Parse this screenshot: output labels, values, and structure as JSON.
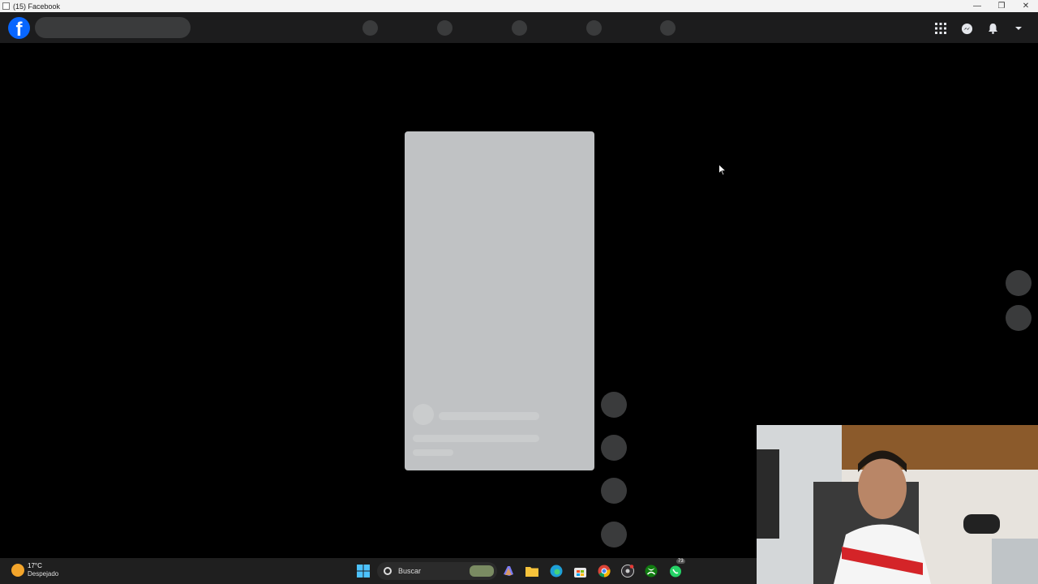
{
  "window": {
    "title": "(15) Facebook"
  },
  "taskbar": {
    "weather": {
      "temp": "17°C",
      "condition": "Despejado"
    },
    "search_label": "Buscar",
    "whatsapp_badge": "73"
  },
  "icons": [
    "app-icon",
    "minimize-icon",
    "restore-icon",
    "close-icon",
    "facebook-logo",
    "apps-grid-icon",
    "messenger-icon",
    "notifications-icon",
    "account-caret-icon",
    "windows-start-icon",
    "search-icon",
    "copilot-icon",
    "file-explorer-icon",
    "edge-icon",
    "microsoft-store-icon",
    "chrome-icon",
    "obs-icon",
    "xbox-icon",
    "whatsapp-icon"
  ]
}
